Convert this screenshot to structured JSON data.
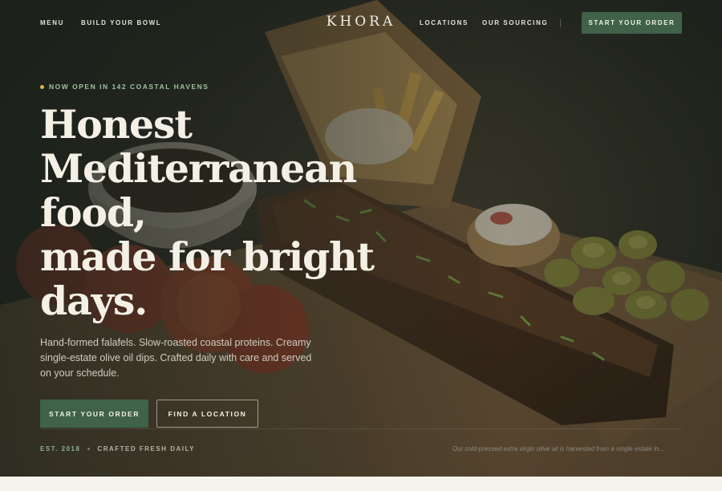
{
  "brand": {
    "logo": "KHORA"
  },
  "nav": {
    "left": [
      "MENU",
      "BUILD YOUR BOWL"
    ],
    "right": [
      "LOCATIONS",
      "OUR SOURCING"
    ],
    "cta": "START YOUR ORDER"
  },
  "hero": {
    "eyebrow": "NOW OPEN IN 142 COASTAL HAVENS",
    "headline_lines": [
      "Honest",
      "Mediterranean",
      "food,",
      "made for bright",
      "days."
    ],
    "subtext": "Hand-formed falafels. Slow-roasted coastal proteins. Creamy single-estate olive oil dips. Crafted daily with care and served on your schedule.",
    "primary_button": "START YOUR ORDER",
    "secondary_button": "FIND A LOCATION",
    "meta_established": "EST. 2018",
    "meta_tagline": "CRAFTED FRESH DAILY",
    "quote": "Our cold-pressed extra virgin olive oil is harvested from a single estate in..."
  },
  "colors": {
    "accent": "#3f6249",
    "eyebrow_dot": "#d9b34a",
    "background_below": "#f6f3ec"
  }
}
